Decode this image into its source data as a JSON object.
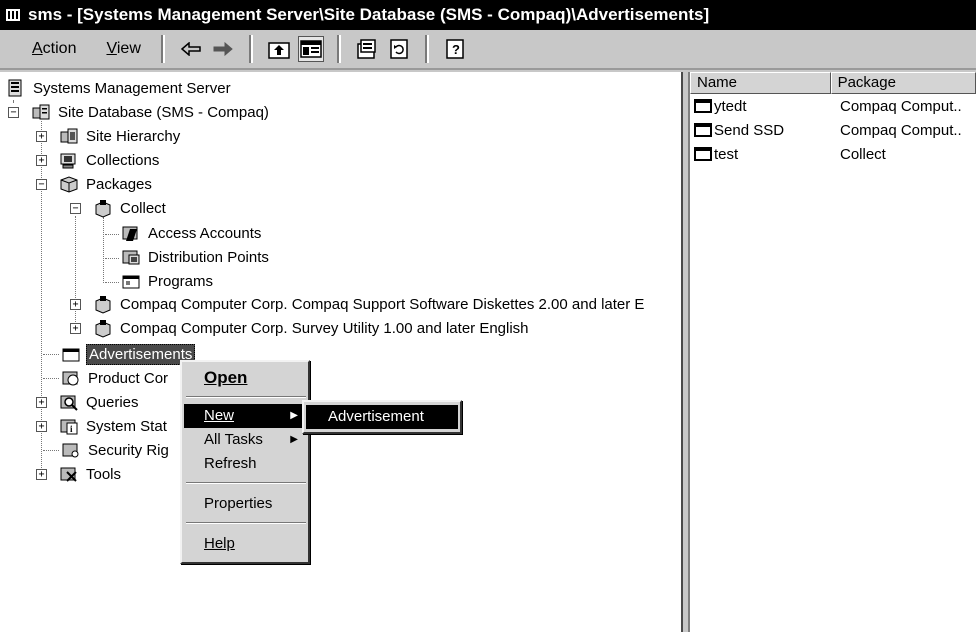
{
  "window": {
    "title": "sms - [Systems Management Server\\Site Database (SMS - Compaq)\\Advertisements]"
  },
  "menu": {
    "action": "Action",
    "view": "View"
  },
  "toolbar_icons": [
    "back-arrow-icon",
    "forward-arrow-icon",
    "up-folder-icon",
    "show-hide-tree-icon",
    "properties-icon",
    "refresh-icon",
    "help-icon"
  ],
  "tree": {
    "root": "Systems Management Server",
    "site_db": "Site Database (SMS - Compaq)",
    "site_hierarchy": "Site Hierarchy",
    "collections": "Collections",
    "packages": "Packages",
    "collect": "Collect",
    "access_accounts": "Access Accounts",
    "distribution_points": "Distribution Points",
    "programs": "Programs",
    "compaq_support": "Compaq Computer Corp. Compaq Support Software Diskettes 2.00 and later E",
    "compaq_survey": "Compaq Computer Corp. Survey Utility 1.00 and later English",
    "advertisements": "Advertisements",
    "product_compliance": "Product Cor",
    "queries": "Queries",
    "system_status": "System Stat",
    "security_rights": "Security Rig",
    "tools": "Tools"
  },
  "list": {
    "columns": [
      "Name",
      "Package"
    ],
    "rows": [
      {
        "name": "ytedt",
        "package": "Compaq Comput.."
      },
      {
        "name": "Send SSD",
        "package": "Compaq Comput.."
      },
      {
        "name": "test",
        "package": "Collect"
      }
    ]
  },
  "context_menu": {
    "open_label": "Open",
    "new_label": "New",
    "all_tasks_label": "All Tasks",
    "refresh_label": "Refresh",
    "properties_label": "Properties",
    "help_label": "Help"
  },
  "submenu": {
    "advertisement_label": "Advertisement"
  }
}
